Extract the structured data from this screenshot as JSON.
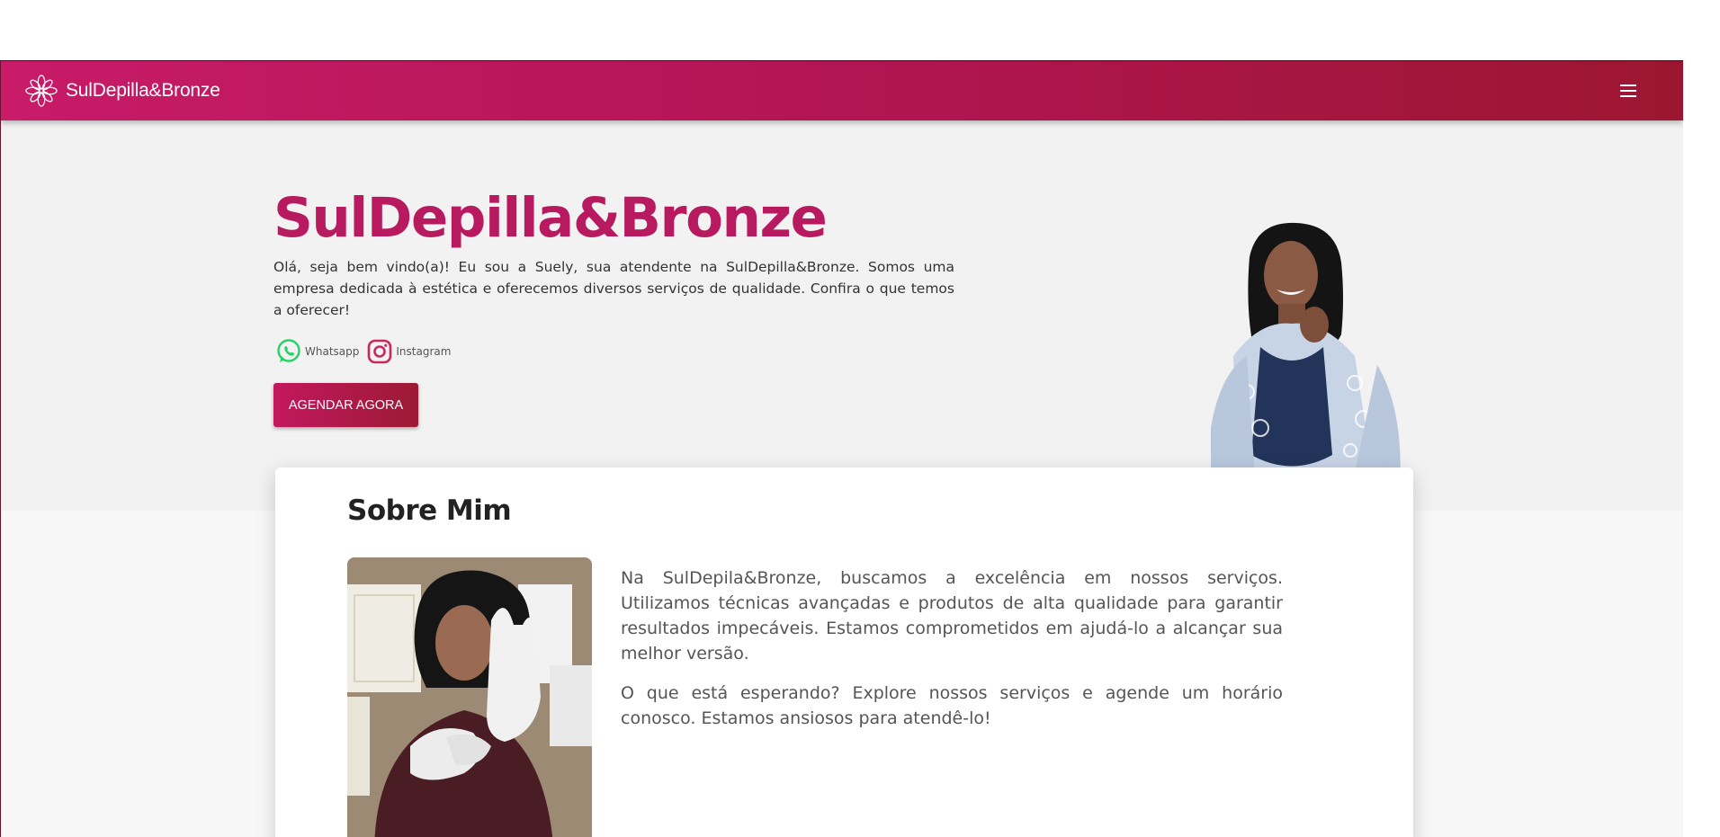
{
  "navbar": {
    "brand_name": "SulDepilla&Bronze",
    "logo_icon": "lotus-mandala-icon",
    "menu_icon": "hamburger-menu-icon"
  },
  "hero": {
    "title": "SulDepilla&Bronze",
    "intro": "Olá, seja bem vindo(a)! Eu sou a Suely, sua atendente na SulDepilla&Bronze. Somos uma empresa dedicada à estética e oferecemos diversos serviços de qualidade. Confira o que temos a oferecer!",
    "social": [
      {
        "label": "Whatsapp",
        "icon": "whatsapp-icon"
      },
      {
        "label": "Instagram",
        "icon": "instagram-icon"
      }
    ],
    "cta_label": "AGENDAR AGORA"
  },
  "about": {
    "title": "Sobre Mim",
    "paragraphs": [
      "Na SulDepila&Bronze, buscamos a excelência em nossos serviços. Utilizamos técnicas avançadas e produtos de alta qualidade para garantir resultados impecáveis. Estamos comprometidos em ajudá-lo a alcançar sua melhor versão.",
      "O que está esperando? Explore nossos serviços e agende um horário conosco. Estamos ansiosos para atendê-lo!"
    ]
  },
  "colors": {
    "brand_primary": "#b81a5f",
    "navbar_start": "#c81b68",
    "navbar_end": "#9c1631",
    "whatsapp": "#25d366",
    "instagram": "#c9285e"
  }
}
